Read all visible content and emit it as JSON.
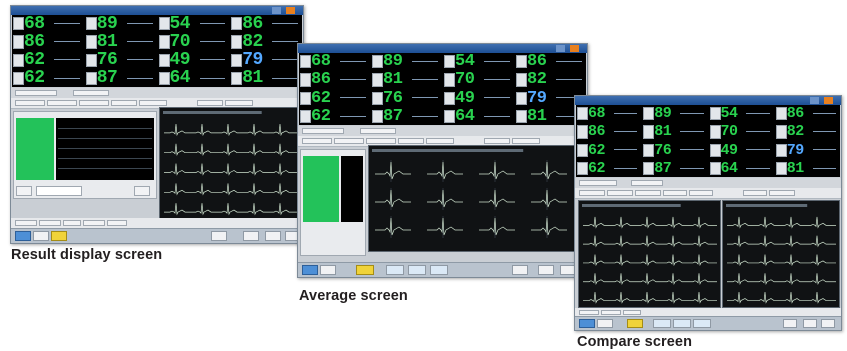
{
  "screens": [
    {
      "caption": "Result display screen",
      "readings": [
        "68",
        "89",
        "54",
        "86",
        "86",
        "81",
        "70",
        "82",
        "62",
        "76",
        "49",
        "79",
        "62",
        "87",
        "64",
        "81"
      ],
      "highlight_index": 11
    },
    {
      "caption": "Average screen",
      "readings": [
        "68",
        "89",
        "54",
        "86",
        "86",
        "81",
        "70",
        "82",
        "62",
        "76",
        "49",
        "79",
        "62",
        "87",
        "64",
        "81"
      ],
      "highlight_index": 11
    },
    {
      "caption": "Compare screen",
      "readings": [
        "68",
        "89",
        "54",
        "86",
        "86",
        "81",
        "70",
        "82",
        "62",
        "76",
        "49",
        "79",
        "62",
        "87",
        "64",
        "81"
      ],
      "highlight_index": 11
    }
  ],
  "colors": {
    "vital_value": "#29d24f",
    "vital_value_highlight": "#54a8ff",
    "waveform": "#cfe3cf",
    "titlebar": "#1d4f94",
    "close_button": "#e8801f"
  },
  "icons": [
    "close-icon",
    "minimize-icon"
  ]
}
